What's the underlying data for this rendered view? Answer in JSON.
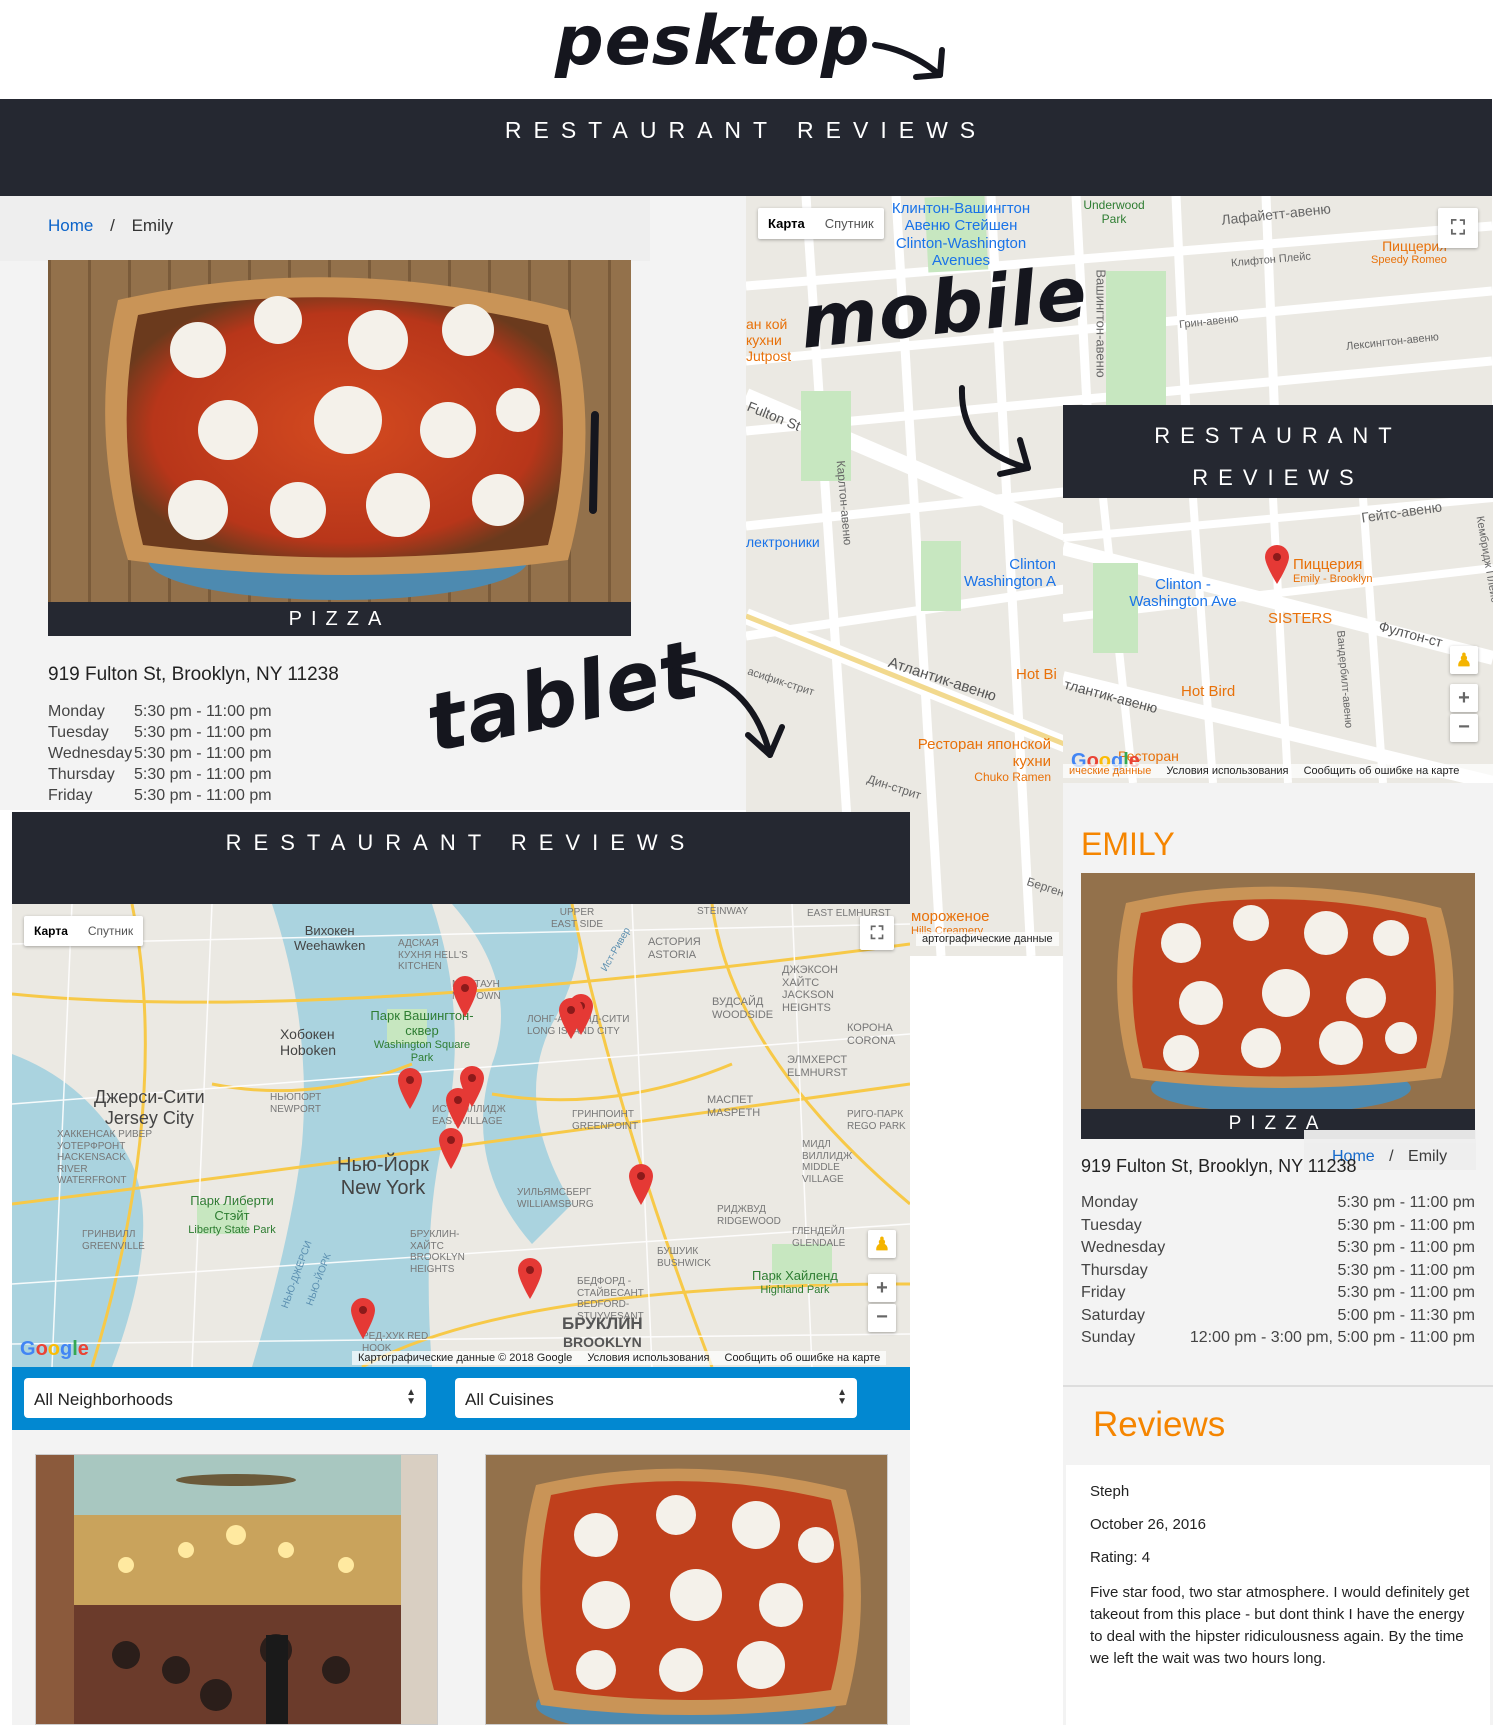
{
  "annotations": {
    "desktop": "pesktop",
    "mobile": "mobile",
    "tablet": "tablet"
  },
  "desktop": {
    "nav_title": "RESTAURANT REVIEWS",
    "breadcrumb": {
      "home": "Home",
      "separator": "/",
      "current": "Emily"
    },
    "cuisine": "PIZZA",
    "address": "919 Fulton St, Brooklyn, NY 11238",
    "hours": [
      {
        "day": "Monday",
        "time": "5:30 pm - 11:00 pm"
      },
      {
        "day": "Tuesday",
        "time": "5:30 pm - 11:00 pm"
      },
      {
        "day": "Wednesday",
        "time": "5:30 pm - 11:00 pm"
      },
      {
        "day": "Thursday",
        "time": "5:30 pm - 11:00 pm"
      },
      {
        "day": "Friday",
        "time": "5:30 pm - 11:00 pm"
      }
    ],
    "map": {
      "type_map": "Карта",
      "type_satellite": "Спутник",
      "labels": {
        "station": "Клинтон-Вашингтон Авеню Стейшен",
        "station_en": "Clinton-Washington Avenues",
        "lafayette": "Лафайетт-авеню",
        "pizzeria_ru": "Пиццерия",
        "pizzeria_en": "Speedy Romeo",
        "underwood": "Underwood Park",
        "clinton_place": "Клифтон Плейс",
        "green_ave": "Грин-авеню",
        "lexington": "Лексингтон-авеню",
        "fulton": "Fulton St",
        "outpost": "ан кой кухни Jutpost",
        "carlton": "Карлтон-авеню",
        "washington_ave": "Вашингтон-авеню",
        "clinton_wa": "Clinton Washington A",
        "electronics": "лектроники",
        "atlantic": "Атлантик-авеню",
        "hot_bird": "Hot Bi",
        "restaurant_ru": "Ресторан японской кухни",
        "restaurant_en": "Chuko Ramen",
        "dean": "Дин-стрит",
        "pacific": "асифик-стрит",
        "bergen": "Берген",
        "icecream": "мороженое",
        "icecream_en": "Hills Creamery",
        "attrib": "артографические данные"
      }
    }
  },
  "mobile": {
    "nav_title_line1": "RESTAURANT",
    "nav_title_line2": "REVIEWS",
    "name": "EMILY",
    "cuisine": "PIZZA",
    "breadcrumb": {
      "home": "Home",
      "separator": "/",
      "current": "Emily"
    },
    "address": "919 Fulton St, Brooklyn, NY 11238",
    "hours": [
      {
        "day": "Monday",
        "time": "5:30 pm - 11:00 pm"
      },
      {
        "day": "Tuesday",
        "time": "5:30 pm - 11:00 pm"
      },
      {
        "day": "Wednesday",
        "time": "5:30 pm - 11:00 pm"
      },
      {
        "day": "Thursday",
        "time": "5:30 pm - 11:00 pm"
      },
      {
        "day": "Friday",
        "time": "5:30 pm - 11:00 pm"
      },
      {
        "day": "Saturday",
        "time": "5:00 pm - 11:30 pm"
      },
      {
        "day": "Sunday",
        "time": "12:00 pm - 3:00 pm, 5:00 pm - 11:00 pm"
      }
    ],
    "reviews_title": "Reviews",
    "review": {
      "name": "Steph",
      "date": "October 26, 2016",
      "rating": "Rating: 4",
      "comments": "Five star food, two star atmosphere. I would definitely get takeout from this place - but dont think I have the energy to deal with the hipster ridiculousness again. By the time we left the wait was two hours long."
    },
    "map": {
      "gates": "Гейтс-авеню",
      "cambridge": "Кембридж Плейс",
      "pin_ru": "Пиццерия",
      "pin_en": "Emily - Brooklyn",
      "clinton": "Clinton - Washington Ave",
      "sisters": "SISTERS",
      "fulton": "Фултон-ст",
      "hot_bird": "Hot Bird",
      "atlantic": "тлантик-авеню",
      "vanderbilt": "Вандербилт-авеню",
      "restaurant": "Ресторан",
      "attrib_data": "ические данные",
      "terms": "Условия использования",
      "report": "Сообщить об ошибке на карте"
    }
  },
  "tablet": {
    "nav_title": "RESTAURANT REVIEWS",
    "map": {
      "type_map": "Карта",
      "type_satellite": "Спутник",
      "attrib": "Картографические данные © 2018 Google",
      "terms": "Условия использования",
      "report": "Сообщить об ошибке на карте",
      "labels": {
        "weehawken_ru": "Вихокен",
        "weehawken": "Weehawken",
        "hoboken_ru": "Хобокен",
        "hoboken": "Hoboken",
        "jersey_ru": "Джерси-Сити",
        "jersey": "Jersey City",
        "park_ru": "Парк Вашингтон-сквер",
        "park": "Washington Square Park",
        "ny_ru": "Нью-Йорк",
        "ny": "New York",
        "liberty_ru": "Парк Либерти Стэйт",
        "liberty": "Liberty State Park",
        "brooklyn_ru": "БРУКЛИН",
        "brooklyn": "BROOKLYN",
        "astoria": "АСТОРИЯ ASTORIA",
        "highland_ru": "Парк Хайленд",
        "highland": "Highland Park",
        "jackson": "ДЖЭКСОН ХАЙТС JACKSON HEIGHTS",
        "woodside": "ВУДСАЙД WOODSIDE",
        "corona": "КОРОНА CORONA",
        "elmhurst": "ЭЛМХЕРСТ ELMHURST",
        "maspeth": "МАСПЕТ MASPETH",
        "greenpoint": "ГРИНПОИНТ GREENPOINT",
        "williamsburg": "УИЛЬЯМСБЕРГ WILLIAMSBURG",
        "bushwick": "БУШУИК BUSHWICK",
        "bedford": "БЕДФОРД - СТАЙВЕСАНТ BEDFORD-STUYVESANT",
        "ridgewood": "РИДЖВУД RIDGEWOOD",
        "glendale": "ГЛЕНДЕЙЛ GLENDALE",
        "middle": "МИДЛ ВИЛЛИДЖ MIDDLE VILLAGE",
        "rego": "РИГО-ПАРК REGO PARK",
        "lic": "ЛОНГ-АЙЛЕНД-СИТИ LONG ISLAND CITY",
        "hackensack": "ХАККЕНСАК РИВЕР УОТЕРФРОНТ HACKENSACK RIVER WATERFRONT",
        "greenville": "ГРИНВИЛЛ GREENVILLE",
        "newport": "НЬЮПОРТ NEWPORT",
        "brooklyn_heights": "БРУКЛИН-ХАЙТС BROOKLYN HEIGHTS",
        "red_hook": "РЕД-ХУК RED HOOK",
        "upper_east": "UPPER EAST SIDE",
        "steinway": "STEINWAY",
        "east_elmhurst": "EAST ELMHURST",
        "hells": "АДСКАЯ КУХНЯ HELL'S KITCHEN",
        "east_river": "Ист-Ривер",
        "village": "ИСТ-ВИЛЛИДЖ EAST VILLAGE",
        "midtown": "МИДТАУН MIDTOWN",
        "hudson": "НЬЮ-ДЖЕРСИ",
        "hudson2": "НЬЮ-ЙОРК"
      }
    },
    "filters": {
      "neighborhoods": "All Neighborhoods",
      "cuisines": "All Cuisines"
    }
  },
  "colors": {
    "nav": "#252831",
    "accent": "#f58500",
    "filter_bar": "#0288d1",
    "link": "#0b63c9"
  }
}
